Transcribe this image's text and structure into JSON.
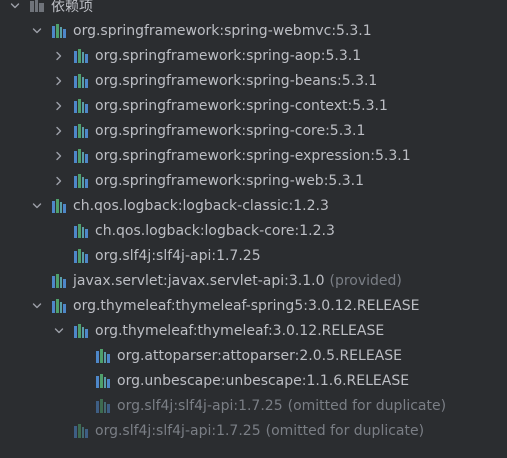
{
  "root": {
    "label": "依赖项",
    "icon": "library-root-icon"
  },
  "colors": {
    "background": "#2b2d30",
    "text": "#bcbec4",
    "dim_text": "#7a7e85",
    "icon_blue": "#4e87c9",
    "icon_green": "#4f9f6b",
    "icon_teal": "#5a9fa7"
  },
  "items": [
    {
      "label": "org.springframework:spring-webmvc:5.3.1",
      "suffix": "",
      "level": 0,
      "arrow": "expanded"
    },
    {
      "label": "org.springframework:spring-aop:5.3.1",
      "suffix": "",
      "level": 1,
      "arrow": "collapsed"
    },
    {
      "label": "org.springframework:spring-beans:5.3.1",
      "suffix": "",
      "level": 1,
      "arrow": "collapsed"
    },
    {
      "label": "org.springframework:spring-context:5.3.1",
      "suffix": "",
      "level": 1,
      "arrow": "collapsed"
    },
    {
      "label": "org.springframework:spring-core:5.3.1",
      "suffix": "",
      "level": 1,
      "arrow": "collapsed"
    },
    {
      "label": "org.springframework:spring-expression:5.3.1",
      "suffix": "",
      "level": 1,
      "arrow": "collapsed"
    },
    {
      "label": "org.springframework:spring-web:5.3.1",
      "suffix": "",
      "level": 1,
      "arrow": "collapsed"
    },
    {
      "label": "ch.qos.logback:logback-classic:1.2.3",
      "suffix": "",
      "level": 0,
      "arrow": "expanded"
    },
    {
      "label": "ch.qos.logback:logback-core:1.2.3",
      "suffix": "",
      "level": 1,
      "arrow": "none"
    },
    {
      "label": "org.slf4j:slf4j-api:1.7.25",
      "suffix": "",
      "level": 1,
      "arrow": "none"
    },
    {
      "label": "javax.servlet:javax.servlet-api:3.1.0",
      "suffix": "(provided)",
      "level": 0,
      "arrow": "none"
    },
    {
      "label": "org.thymeleaf:thymeleaf-spring5:3.0.12.RELEASE",
      "suffix": "",
      "level": 0,
      "arrow": "expanded"
    },
    {
      "label": "org.thymeleaf:thymeleaf:3.0.12.RELEASE",
      "suffix": "",
      "level": 1,
      "arrow": "expanded"
    },
    {
      "label": "org.attoparser:attoparser:2.0.5.RELEASE",
      "suffix": "",
      "level": 2,
      "arrow": "none"
    },
    {
      "label": "org.unbescape:unbescape:1.1.6.RELEASE",
      "suffix": "",
      "level": 2,
      "arrow": "none"
    },
    {
      "label": "org.slf4j:slf4j-api:1.7.25",
      "suffix": "(omitted for duplicate)",
      "level": 2,
      "arrow": "none",
      "dim": true
    },
    {
      "label": "org.slf4j:slf4j-api:1.7.25",
      "suffix": "(omitted for duplicate)",
      "level": 1,
      "arrow": "none",
      "dim": true
    }
  ]
}
